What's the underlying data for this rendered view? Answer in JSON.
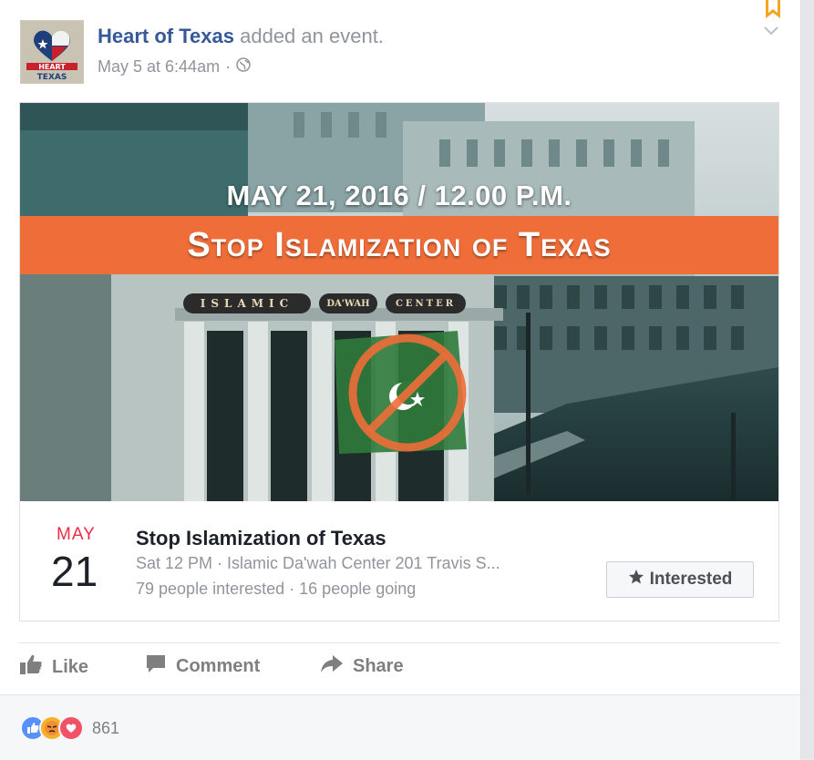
{
  "post": {
    "page_name": "Heart of Texas",
    "action_text": "added an event.",
    "timestamp": "May 5 at 6:44am",
    "separator": "·",
    "avatar_text_top": "HEART",
    "avatar_text_bottom": "TEXAS",
    "avatar_icon": "texas-heart-logo",
    "privacy_icon": "globe-icon"
  },
  "banner": {
    "date_time": "MAY 21, 2016 / 12.00 P.M.",
    "title": "Stop Islamization of Texas",
    "sign_word_1": "ISLAMIC",
    "sign_word_2": "DA'WAH",
    "sign_word_3": "CENTER",
    "accent_color": "#ee6d39"
  },
  "event": {
    "month": "MAY",
    "day": "21",
    "title": "Stop Islamization of Texas",
    "when_where": "Sat 12 PM · Islamic Da'wah Center 201 Travis S...",
    "interested_count": "79 people interested",
    "going_count": "16 people going",
    "stats_separator": "·",
    "interested_button": "Interested",
    "interested_icon": "star-icon"
  },
  "actions": {
    "like": "Like",
    "comment": "Comment",
    "share": "Share"
  },
  "reactions": {
    "types": [
      "like-reaction-icon",
      "angry-reaction-icon",
      "love-reaction-icon"
    ],
    "count": "861"
  },
  "colors": {
    "link": "#365899",
    "muted": "#90949c",
    "date_red": "#f02849"
  }
}
